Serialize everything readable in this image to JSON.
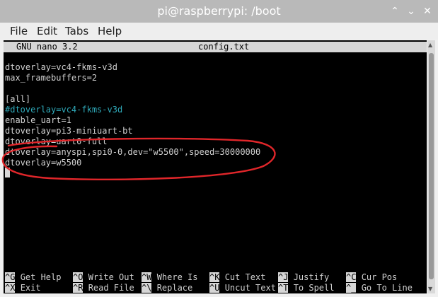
{
  "window": {
    "title": "pi@raspberrypi: /boot",
    "controls": {
      "minimize": "⌃",
      "maximize": "⌄",
      "close": "✕"
    }
  },
  "menubar": {
    "items": [
      "File",
      "Edit",
      "Tabs",
      "Help"
    ]
  },
  "nano": {
    "version": "GNU nano 3.2",
    "filename": "config.txt",
    "lines": [
      "dtoverlay=vc4-fkms-v3d",
      "max_framebuffers=2",
      "",
      "[all]",
      "#dtoverlay=vc4-fkms-v3d",
      "enable_uart=1",
      "dtoverlay=pi3-miniuart-bt",
      "dtoverlay=uart0-full",
      "dtoverlay=anyspi,spi0-0,dev=\"w5500\",speed=30000000",
      "dtoverlay=w5500"
    ],
    "shortcuts_row1": [
      {
        "key": "^G",
        "label": "Get Help"
      },
      {
        "key": "^O",
        "label": "Write Out"
      },
      {
        "key": "^W",
        "label": "Where Is"
      },
      {
        "key": "^K",
        "label": "Cut Text"
      },
      {
        "key": "^J",
        "label": "Justify"
      },
      {
        "key": "^C",
        "label": "Cur Pos"
      }
    ],
    "shortcuts_row2": [
      {
        "key": "^X",
        "label": "Exit"
      },
      {
        "key": "^R",
        "label": "Read File"
      },
      {
        "key": "^\\",
        "label": "Replace"
      },
      {
        "key": "^U",
        "label": "Uncut Text"
      },
      {
        "key": "^T",
        "label": "To Spell"
      },
      {
        "key": "^_",
        "label": "Go To Line"
      }
    ]
  },
  "colors": {
    "comment": "#2fa9b9",
    "highlight": "#e0262a",
    "terminal_bg": "#000000"
  }
}
